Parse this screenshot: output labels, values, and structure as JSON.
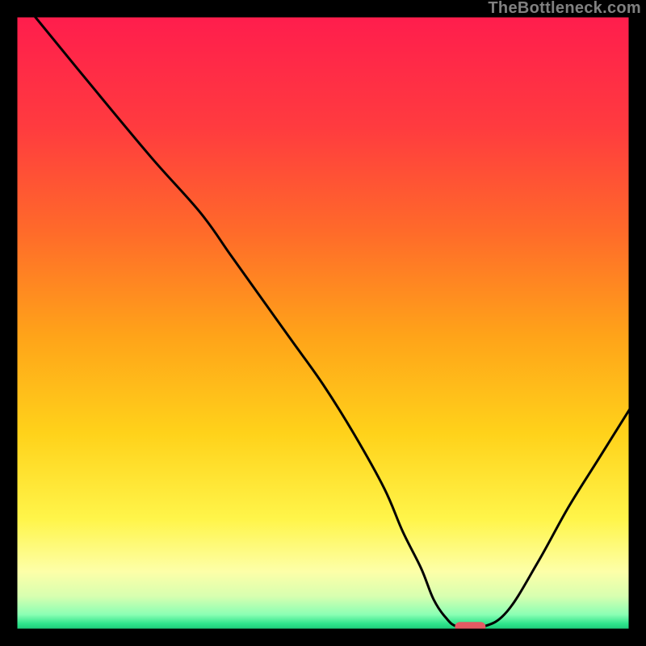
{
  "watermark": "TheBottleneck.com",
  "gradient": {
    "stops": [
      {
        "offset": 0.0,
        "color": "#ff1d4d"
      },
      {
        "offset": 0.18,
        "color": "#ff3b3f"
      },
      {
        "offset": 0.35,
        "color": "#ff6a2a"
      },
      {
        "offset": 0.52,
        "color": "#ffa319"
      },
      {
        "offset": 0.68,
        "color": "#ffd21a"
      },
      {
        "offset": 0.82,
        "color": "#fff54a"
      },
      {
        "offset": 0.905,
        "color": "#fdffa8"
      },
      {
        "offset": 0.945,
        "color": "#d8ffb0"
      },
      {
        "offset": 0.975,
        "color": "#8bffb4"
      },
      {
        "offset": 0.99,
        "color": "#2fe48c"
      },
      {
        "offset": 1.0,
        "color": "#1bc877"
      }
    ]
  },
  "chart_data": {
    "type": "line",
    "title": "",
    "xlabel": "",
    "ylabel": "",
    "xlim": [
      0,
      100
    ],
    "ylim": [
      0,
      100
    ],
    "x": [
      3,
      12,
      22,
      30,
      35,
      40,
      45,
      50,
      55,
      60,
      63,
      66,
      68,
      70,
      72,
      76,
      80,
      85,
      90,
      95,
      100
    ],
    "values": [
      100,
      89,
      77,
      68,
      61,
      54,
      47,
      40,
      32,
      23,
      16,
      10,
      5,
      2,
      0.5,
      0.5,
      3,
      11,
      20,
      28,
      36
    ],
    "minimum_marker": {
      "x_center": 74,
      "y": 0.5,
      "width": 5,
      "color": "#e35a63"
    }
  }
}
